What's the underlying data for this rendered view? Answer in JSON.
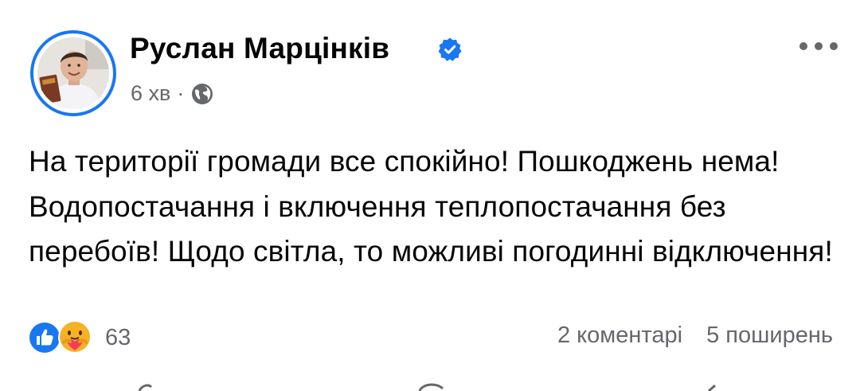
{
  "post": {
    "author": {
      "name": "Руслан Марцінків",
      "verified_icon": "verified-badge-icon",
      "avatar": "profile-photo"
    },
    "meta": {
      "time": "6 хв",
      "separator": "·",
      "audience_icon": "globe-icon"
    },
    "more_icon": "more-dots-icon",
    "text": "На території громади все спокійно! Пошкоджень нема! Водопостачання і включення теплопостачання без перебоїв! Щодо світла, то можливі погодинні відключення!",
    "reactions": {
      "icons": [
        "like-icon",
        "care-icon"
      ],
      "count": "63"
    },
    "stats": {
      "comments": "2 коментарі",
      "shares": "5 поширень"
    }
  },
  "colors": {
    "accent": "#1877f2",
    "text_primary": "#050505",
    "text_secondary": "#65676b",
    "care_yellow": "#f7b125",
    "love_red": "#f33e58"
  }
}
